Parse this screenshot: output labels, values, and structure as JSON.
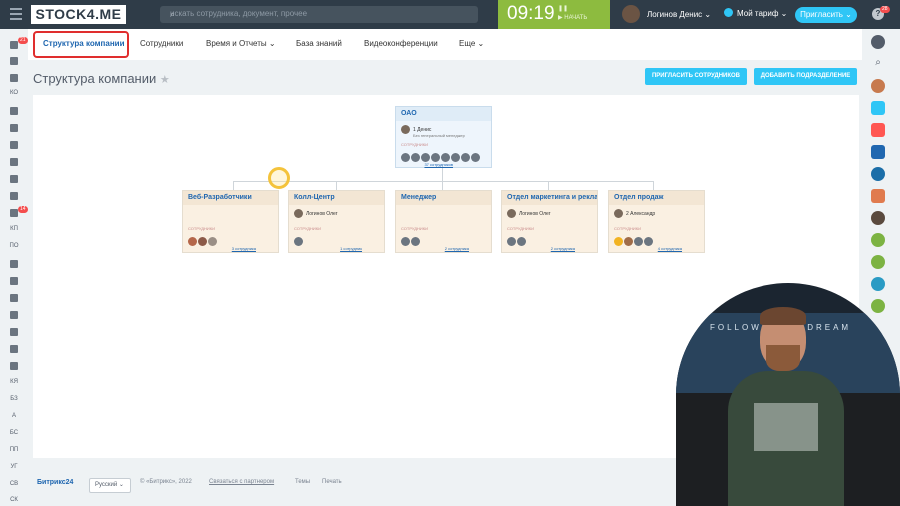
{
  "header": {
    "logo": "STOCK4.ME",
    "search_placeholder": "искать сотрудника, документ, прочее",
    "clock": "09:19",
    "clock_state": "НАЧАТЬ",
    "user_name": "Логинов Денис",
    "tariff": "Мой тариф",
    "invite": "Пригласить",
    "notif_count": "28"
  },
  "tabs": [
    {
      "label": "Структура компании",
      "active": true
    },
    {
      "label": "Сотрудники"
    },
    {
      "label": "Время и Отчеты"
    },
    {
      "label": "База знаний"
    },
    {
      "label": "Видеоконференции"
    },
    {
      "label": "Еще"
    }
  ],
  "page": {
    "title": "Структура компании",
    "btn_invite": "ПРИГЛАСИТЬ СОТРУДНИКОВ",
    "btn_add": "ДОБАВИТЬ ПОДРАЗДЕЛЕНИЕ"
  },
  "left_menu": [
    "КО",
    "КП",
    "ПО",
    "КЯ",
    "БЗ",
    "А",
    "БС",
    "ПП",
    "УГ",
    "СВ",
    "СК"
  ],
  "left_badges": {
    "top": "21",
    "mid": "14"
  },
  "org": {
    "root": {
      "name": "ОАО",
      "head": "1 Денис",
      "head_role": "Без генеральный менеджер",
      "label": "СОТРУДНИКИ",
      "count": "37 сотрудников"
    },
    "departments": [
      {
        "name": "Веб-Разработчики",
        "head": "",
        "label": "СОТРУДНИКИ",
        "count": "3 сотрудника"
      },
      {
        "name": "Колл-Центр",
        "head": "Логинов Олег",
        "label": "СОТРУДНИКИ",
        "count": "1 сотрудник"
      },
      {
        "name": "Менеджер",
        "head": "",
        "label": "СОТРУДНИКИ",
        "count": "2 сотрудника"
      },
      {
        "name": "Отдел маркетинга и рекламы",
        "head": "Логинов Олег",
        "label": "СОТРУДНИКИ",
        "count": "2 сотрудника"
      },
      {
        "name": "Отдел продаж",
        "head": "2 Александр",
        "label": "СОТРУДНИКИ",
        "count": "4 сотрудника"
      }
    ]
  },
  "footer": {
    "brand": "Битрикс24",
    "language": "Русский",
    "copyright": "© «Битрикс», 2022",
    "partners": "Связаться с партнером",
    "themes": "Темы",
    "print": "Печать"
  },
  "webcam": {
    "wall_text": "FOLLOW YOUR DREAM"
  },
  "colors": {
    "accent": "#2fc6f6",
    "topbar": "#2f3c48",
    "clock": "#8dbb3f",
    "highlight": "#e02e2e"
  }
}
